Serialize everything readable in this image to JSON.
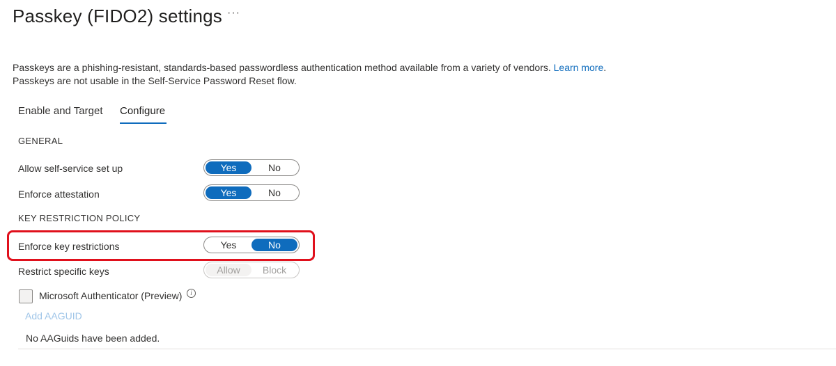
{
  "header": {
    "title": "Passkey (FIDO2) settings",
    "more_icon": "more-icon"
  },
  "description": {
    "line1": "Passkeys are a phishing-resistant, standards-based passwordless authentication method available from a variety of vendors.",
    "learn_more": "Learn more",
    "line1_end": ".",
    "line2": "Passkeys are not usable in the Self-Service Password Reset flow."
  },
  "tabs": [
    {
      "label": "Enable and Target",
      "selected": false
    },
    {
      "label": "Configure",
      "selected": true
    }
  ],
  "general": {
    "heading": "GENERAL",
    "rows": [
      {
        "label": "Allow self-service set up",
        "options": [
          "Yes",
          "No"
        ],
        "selected": "Yes"
      },
      {
        "label": "Enforce attestation",
        "options": [
          "Yes",
          "No"
        ],
        "selected": "Yes"
      }
    ]
  },
  "key_restriction": {
    "heading": "KEY RESTRICTION POLICY",
    "enforce": {
      "label": "Enforce key restrictions",
      "options": [
        "Yes",
        "No"
      ],
      "selected": "No"
    },
    "restrict": {
      "label": "Restrict specific keys",
      "options": [
        "Allow",
        "Block"
      ],
      "selected": "Allow",
      "disabled": true
    },
    "checkbox_label": "Microsoft Authenticator (Preview)",
    "info_icon": "info-icon",
    "add_link": "Add AAGUID",
    "empty_text": "No AAGuids have been added."
  },
  "colors": {
    "accent": "#0f6cbd",
    "highlight": "#e0101c"
  }
}
